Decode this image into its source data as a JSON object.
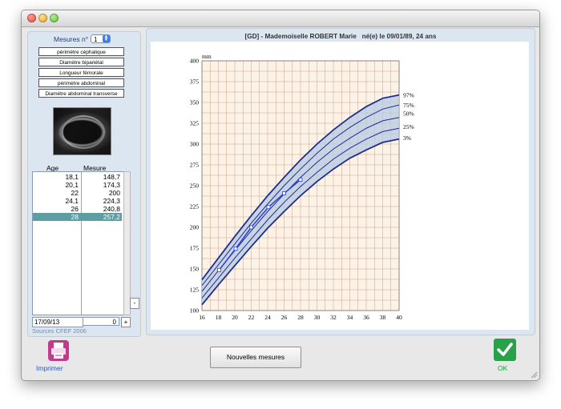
{
  "window": {
    "title": ""
  },
  "left": {
    "mesures_label": "Mesures n°",
    "mesure_number": "1",
    "measure_types": [
      "périmètre céphalique",
      "Diamètre bipariétal",
      "Longueur fémorale",
      "périmètre abdominal",
      "Diamètre abdominal transverse"
    ],
    "table": {
      "headers": [
        "Age",
        "Mesure"
      ],
      "rows": [
        [
          "18,1",
          "148,7"
        ],
        [
          "20,1",
          "174,3"
        ],
        [
          "22",
          "200"
        ],
        [
          "24,1",
          "224,3"
        ],
        [
          "26",
          "240,8"
        ],
        [
          "28",
          "257,2"
        ]
      ],
      "selected_row": 5
    },
    "minus": "-",
    "date": "17/09/13",
    "value": "0",
    "plus": "+",
    "sources": "Sources CFEF 2006"
  },
  "chart_title": "[GD] - Mademoiselle ROBERT Marie   né(e) le 09/01/89, 24 ans",
  "buttons": {
    "print": "Imprimer",
    "new_measures": "Nouvelles mesures",
    "ok": "OK"
  },
  "icons": {
    "print": "printer-icon",
    "ok": "checkmark-icon"
  },
  "colors": {
    "band_fill": "#b7cbe4",
    "curve": "#1e2e8c",
    "grid_bg": "#fdf2e6",
    "grid_line": "#c8a08c",
    "selected_row": "#5c9ea3"
  },
  "chart_data": {
    "type": "line",
    "title": "",
    "xlabel": "",
    "ylabel": "mm",
    "xlim": [
      16,
      40
    ],
    "ylim": [
      100,
      400
    ],
    "x_ticks": [
      16,
      18,
      20,
      22,
      24,
      26,
      28,
      30,
      32,
      34,
      36,
      38,
      40
    ],
    "y_ticks": [
      100,
      125,
      150,
      175,
      200,
      225,
      250,
      275,
      300,
      325,
      350,
      375,
      400
    ],
    "percentile_labels": [
      "97%",
      "75%",
      "50%",
      "25%",
      "3%"
    ],
    "x": [
      16,
      18,
      20,
      22,
      24,
      26,
      28,
      30,
      32,
      34,
      36,
      38,
      40
    ],
    "series": [
      {
        "name": "97%",
        "values": [
          137,
          163,
          189,
          214,
          238,
          260,
          281,
          300,
          317,
          332,
          345,
          355,
          359
        ]
      },
      {
        "name": "75%",
        "values": [
          130,
          155,
          180,
          205,
          228,
          250,
          270,
          289,
          306,
          320,
          332,
          342,
          347
        ]
      },
      {
        "name": "50%",
        "values": [
          123,
          148,
          172,
          196,
          219,
          240,
          260,
          278,
          294,
          307,
          319,
          328,
          332
        ]
      },
      {
        "name": "25%",
        "values": [
          115,
          139,
          163,
          186,
          209,
          230,
          249,
          266,
          282,
          295,
          306,
          315,
          319
        ]
      },
      {
        "name": "3%",
        "values": [
          107,
          131,
          154,
          177,
          199,
          219,
          238,
          255,
          270,
          283,
          293,
          302,
          306
        ]
      }
    ],
    "points": {
      "x": [
        18.1,
        20.1,
        22,
        24.1,
        26,
        28
      ],
      "y": [
        148.7,
        174.3,
        200,
        224.3,
        240.8,
        257.2
      ]
    }
  }
}
